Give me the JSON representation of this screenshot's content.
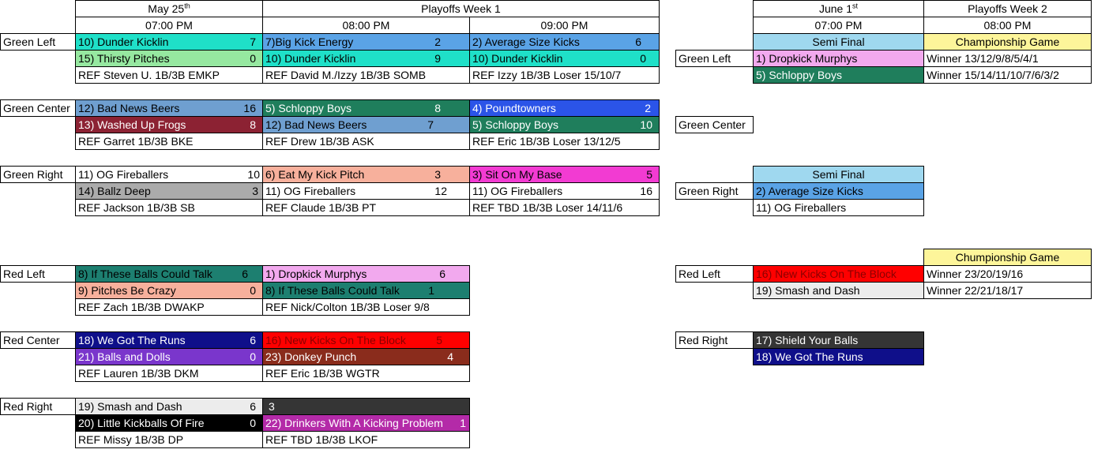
{
  "header_left": {
    "date": "May 25",
    "date_sup": "th",
    "playoffs": "Playoffs Week 1",
    "time1": "07:00 PM",
    "time2": "08:00 PM",
    "time3": "09:00 PM"
  },
  "header_right": {
    "date": "June 1",
    "date_sup": "st",
    "playoffs": "Playoffs Week 2",
    "time1": "07:00 PM",
    "time2": "08:00 PM",
    "semi": "Semi Final",
    "championship": "Championship Game"
  },
  "fields": {
    "green_left": "Green Left",
    "green_center": "Green Center",
    "green_right": "Green Right",
    "red_left": "Red Left",
    "red_center": "Red Center",
    "red_right": "Red Right"
  },
  "gl": {
    "c1": {
      "t1": "10) Dunder Kicklin",
      "s1": "7",
      "t2": "15) Thirsty Pitches",
      "s2": "0",
      "ref": "REF Steven U.   1B/3B EMKP"
    },
    "c2": {
      "t1": "7)Big Kick Energy",
      "s1": "2",
      "t2": "10) Dunder Kicklin",
      "s2": "9",
      "ref": "REF David M./Izzy 1B/3B SOMB"
    },
    "c3": {
      "t1": "2) Average Size Kicks",
      "s1": "6",
      "t2": "10) Dunder Kicklin",
      "s2": "0",
      "ref": "REF Izzy  1B/3B Loser 15/10/7"
    }
  },
  "gc": {
    "c1": {
      "t1": "12) Bad News Beers",
      "s1": "16",
      "t2": "13) Washed Up Frogs",
      "s2": "8",
      "ref": "REF Garret  1B/3B BKE"
    },
    "c2": {
      "t1": "5) Schloppy Boys",
      "s1": "8",
      "t2": "12) Bad News Beers",
      "s2": "7",
      "ref": "REF Drew  1B/3B ASK"
    },
    "c3": {
      "t1": "4) Poundtowners",
      "s1": "2",
      "t2": "5) Schloppy Boys",
      "s2": "10",
      "ref": "REF Eric 1B/3B Loser 13/12/5"
    }
  },
  "gr": {
    "c1": {
      "t1": "11) OG Fireballers",
      "s1": "10",
      "t2": "14) Ballz Deep",
      "s2": "3",
      "ref": "REF Jackson      1B/3B SB"
    },
    "c2": {
      "t1": "6) Eat My Kick Pitch",
      "s1": "3",
      "t2": "11) OG Fireballers",
      "s2": "12",
      "ref": "REF Claude     1B/3B PT"
    },
    "c3": {
      "t1": "3) Sit On My Base",
      "s1": "5",
      "t2": "11) OG Fireballers",
      "s2": "16",
      "ref": "REF TBD 1B/3B Loser 14/11/6"
    }
  },
  "rl": {
    "c1": {
      "t1": "8) If These Balls Could Talk",
      "s1": "6",
      "t2": "9) Pitches Be Crazy",
      "s2": "0",
      "ref": "REF Zach  1B/3B DWAKP"
    },
    "c2": {
      "t1": "1) Dropkick Murphys",
      "s1": "6",
      "t2": "8) If These Balls Could Talk",
      "s2": "1",
      "ref": "REF Nick/Colton 1B/3B Loser 9/8"
    }
  },
  "rc": {
    "c1": {
      "t1": "18) We Got The Runs",
      "s1": "6",
      "t2": "21) Balls and Dolls",
      "s2": "0",
      "ref": "REF Lauren 1B/3B  DKM"
    },
    "c2": {
      "t1": "16) New Kicks On The Block",
      "s1": "5",
      "t2": "23) Donkey Punch",
      "s2": "4",
      "ref": "REF Eric   1B/3B WGTR"
    }
  },
  "rr": {
    "c1": {
      "t1": "19) Smash and Dash",
      "s1": "6",
      "t2": "20) Little Kickballs Of Fire",
      "s2": "0",
      "ref": "REF Missy  1B/3B DP"
    },
    "c2": {
      "t1": "3",
      "t2": "22) Drinkers With A Kicking Problem",
      "s2": "1",
      "ref": "REF TBD 1B/3B LKOF"
    }
  },
  "w2": {
    "gl_semi_t1": "1) Dropkick Murphys",
    "gl_semi_t2": "5) Schloppy Boys",
    "gl_champ_t1": "Winner 13/12/9/8/5/4/1",
    "gl_champ_t2": "Winner 15/14/11/10/7/6/3/2",
    "gr_semi_header": "Semi Final",
    "gr_semi_t1": "2) Average Size Kicks",
    "gr_semi_t2": "11) OG Fireballers",
    "rl_champ_header": "Chumpionship Game",
    "rl_t1": "16) New Kicks On The Block",
    "rl_t2": "19) Smash and Dash",
    "rl_champ_t1": "Winner 23/20/19/16",
    "rl_champ_t2": "Winner 22/21/18/17",
    "rr_t1": "17) Shield Your Balls",
    "rr_t2": "18) We Got The Runs"
  }
}
